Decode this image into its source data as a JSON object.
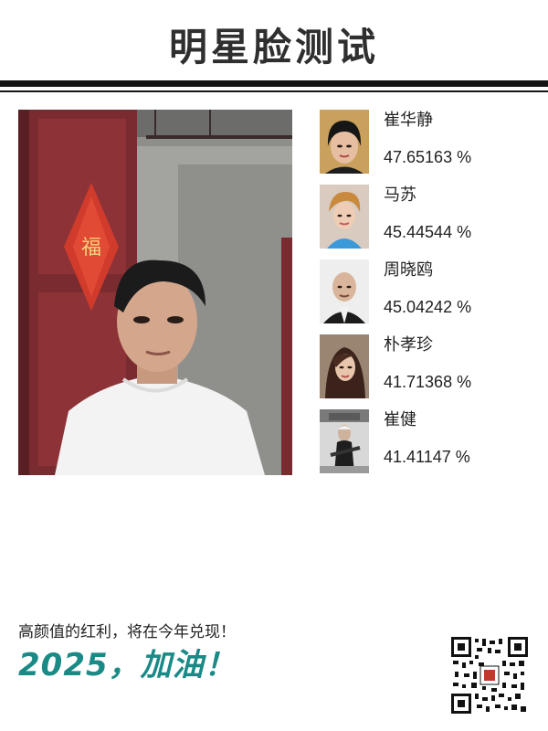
{
  "header": {
    "title": "明星脸测试"
  },
  "main_photo": {
    "icon": "user-photo"
  },
  "matches": [
    {
      "name": "崔华静",
      "score": "47.65163 %"
    },
    {
      "name": "马苏",
      "score": "45.44544 %"
    },
    {
      "name": "周晓鸥",
      "score": "45.04242 %"
    },
    {
      "name": "朴孝珍",
      "score": "41.71368 %"
    },
    {
      "name": "崔健",
      "score": "41.41147 %"
    }
  ],
  "footer": {
    "text": "高颜值的红利，将在今年兑现！",
    "slogan": "2025，加油！"
  },
  "colors": {
    "accent": "#1a8a86",
    "rule": "#141414",
    "text": "#222222"
  },
  "qr": {
    "icon": "qr-code-icon"
  }
}
